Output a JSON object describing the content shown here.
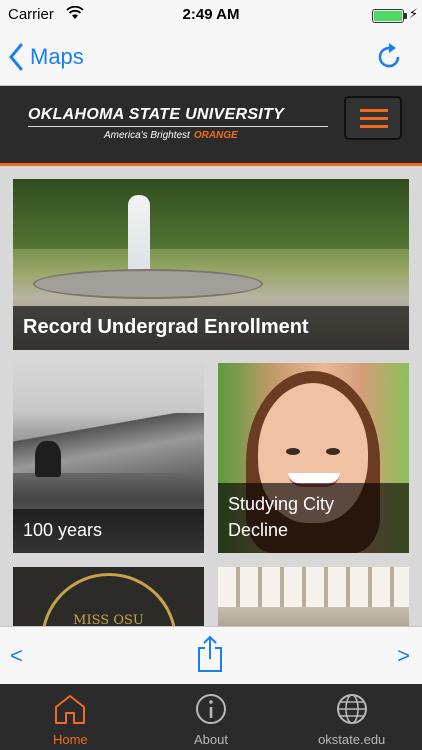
{
  "status_bar": {
    "carrier": "Carrier",
    "time": "2:49 AM",
    "battery_color": "#4cd964"
  },
  "nav_bar": {
    "back_label": "Maps",
    "reload_icon": "refresh-icon"
  },
  "header": {
    "university": "OKLAHOMA STATE UNIVERSITY",
    "tagline": "America's Brightest",
    "tagline_accent": "ORANGE",
    "accent_color": "#f26a21",
    "menu_icon": "hamburger-menu-icon"
  },
  "stories": [
    {
      "title": "Record Undergrad Enrollment"
    },
    {
      "title": "100 years"
    },
    {
      "title": "Studying City Decline"
    },
    {
      "title": "",
      "image_text": "MISS OSU"
    },
    {
      "title": ""
    }
  ],
  "browser_toolbar": {
    "back": "<",
    "forward": ">"
  },
  "tabs": [
    {
      "label": "Home",
      "icon": "home-icon",
      "active": true
    },
    {
      "label": "About",
      "icon": "info-icon",
      "active": false
    },
    {
      "label": "okstate.edu",
      "icon": "globe-icon",
      "active": false
    }
  ]
}
